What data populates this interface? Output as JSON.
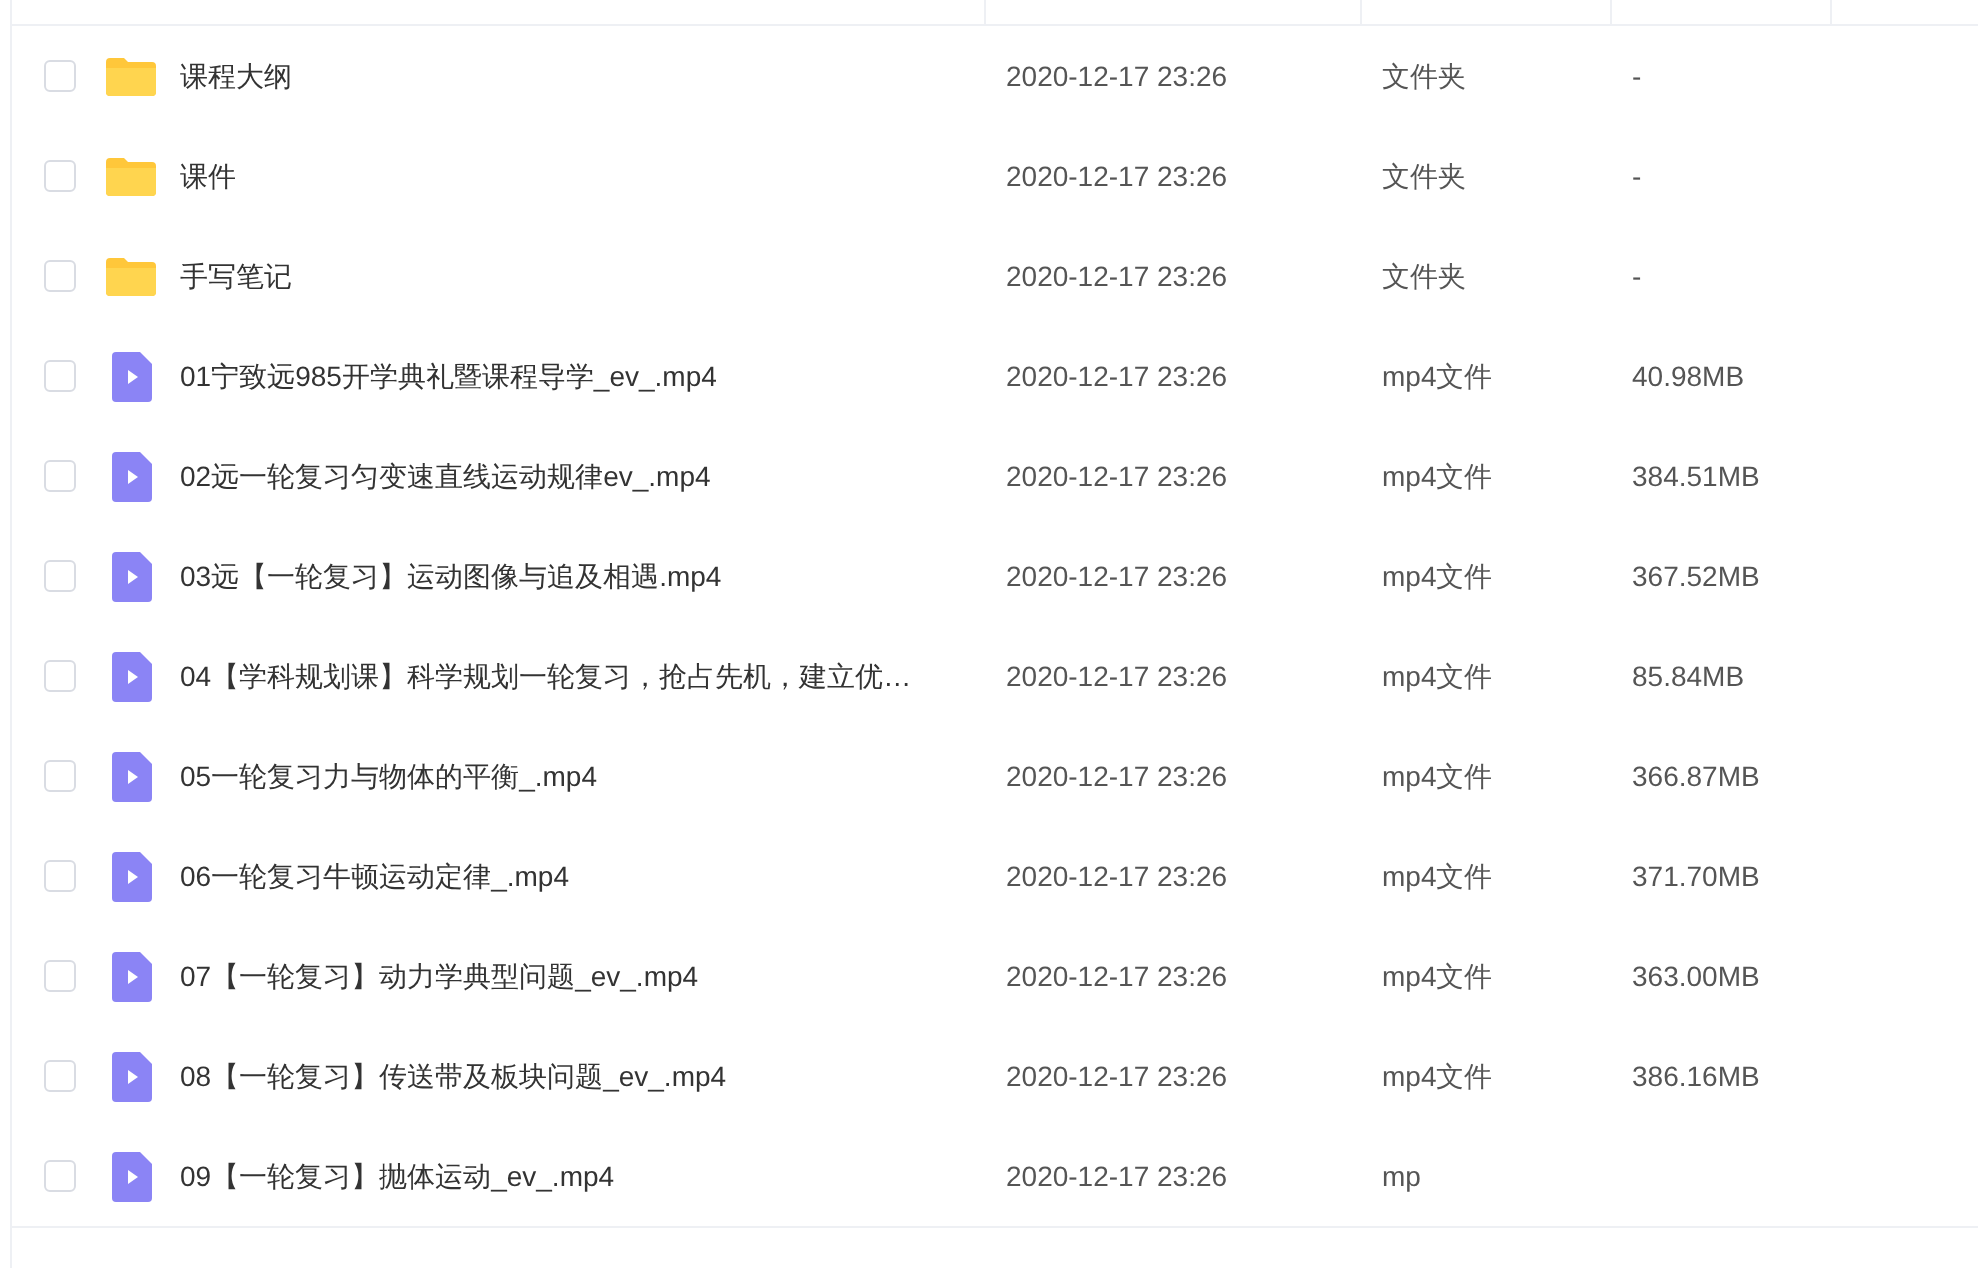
{
  "files": [
    {
      "name": "课程大纲",
      "modified": "2020-12-17 23:26",
      "type": "文件夹",
      "size": "-",
      "kind": "folder",
      "checked": false
    },
    {
      "name": "课件",
      "modified": "2020-12-17 23:26",
      "type": "文件夹",
      "size": "-",
      "kind": "folder",
      "checked": false
    },
    {
      "name": "手写笔记",
      "modified": "2020-12-17 23:26",
      "type": "文件夹",
      "size": "-",
      "kind": "folder",
      "checked": false
    },
    {
      "name": "01宁致远985开学典礼暨课程导学_ev_.mp4",
      "modified": "2020-12-17 23:26",
      "type": "mp4文件",
      "size": "40.98MB",
      "kind": "video",
      "checked": false
    },
    {
      "name": "02远一轮复习匀变速直线运动规律ev_.mp4",
      "modified": "2020-12-17 23:26",
      "type": "mp4文件",
      "size": "384.51MB",
      "kind": "video",
      "checked": false
    },
    {
      "name": "03远【一轮复习】运动图像与追及相遇.mp4",
      "modified": "2020-12-17 23:26",
      "type": "mp4文件",
      "size": "367.52MB",
      "kind": "video",
      "checked": false
    },
    {
      "name": "04【学科规划课】科学规划一轮复习，抢占先机，建立优…",
      "modified": "2020-12-17 23:26",
      "type": "mp4文件",
      "size": "85.84MB",
      "kind": "video",
      "checked": false
    },
    {
      "name": "05一轮复习力与物体的平衡_.mp4",
      "modified": "2020-12-17 23:26",
      "type": "mp4文件",
      "size": "366.87MB",
      "kind": "video",
      "checked": false
    },
    {
      "name": "06一轮复习牛顿运动定律_.mp4",
      "modified": "2020-12-17 23:26",
      "type": "mp4文件",
      "size": "371.70MB",
      "kind": "video",
      "checked": false
    },
    {
      "name": "07【一轮复习】动力学典型问题_ev_.mp4",
      "modified": "2020-12-17 23:26",
      "type": "mp4文件",
      "size": "363.00MB",
      "kind": "video",
      "checked": false
    },
    {
      "name": "08【一轮复习】传送带及板块问题_ev_.mp4",
      "modified": "2020-12-17 23:26",
      "type": "mp4文件",
      "size": "386.16MB",
      "kind": "video",
      "checked": false
    },
    {
      "name": "09【一轮复习】抛体运动_ev_.mp4",
      "modified": "2020-12-17 23:26",
      "type": "mp",
      "kind": "video",
      "checked": false
    }
  ]
}
